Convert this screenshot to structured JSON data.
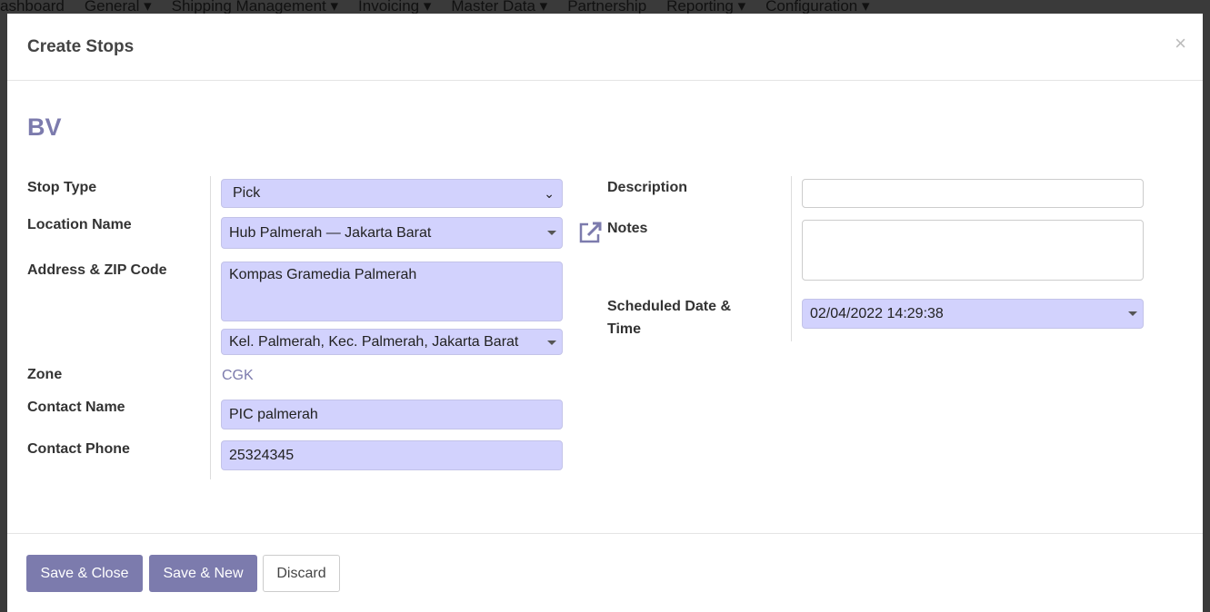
{
  "nav": [
    "ashboard",
    "General ▾",
    "Shipping Management ▾",
    "Invoicing ▾",
    "Master Data ▾",
    "Partnership",
    "Reporting ▾",
    "Configuration ▾"
  ],
  "modal": {
    "title": "Create Stops",
    "close": "×"
  },
  "record_title": "BV",
  "labels": {
    "stop_type": "Stop Type",
    "location": "Location Name",
    "address": "Address & ZIP Code",
    "zone": "Zone",
    "contact_name": "Contact Name",
    "contact_phone": "Contact Phone",
    "description": "Description",
    "notes": "Notes",
    "scheduled": "Scheduled Date & Time"
  },
  "values": {
    "stop_type": "Pick",
    "location": "Hub Palmerah — Jakarta Barat",
    "address": "Kompas Gramedia Palmerah",
    "zip": "Kel. Palmerah, Kec. Palmerah, Jakarta Barat",
    "zone": "CGK",
    "contact_name": "PIC palmerah",
    "contact_phone": "25324345",
    "description": "",
    "notes": "",
    "scheduled": "02/04/2022 14:29:38"
  },
  "buttons": {
    "save_close": "Save & Close",
    "save_new": "Save & New",
    "discard": "Discard"
  },
  "icons": {
    "external_link": "external-link-icon"
  },
  "colors": {
    "accent": "#7c7bad",
    "input_bg": "#d2d2fd"
  }
}
